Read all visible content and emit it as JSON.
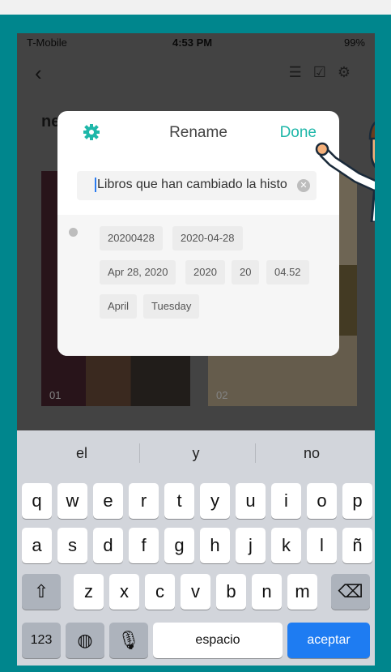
{
  "status": {
    "carrier": "T-Mobile",
    "time": "4:53 PM",
    "battery": "99%"
  },
  "doc": {
    "title_partial": "ne",
    "thumbs": [
      "01",
      "02"
    ]
  },
  "modal": {
    "title": "Rename",
    "done": "Done",
    "filename": "Libros que han cambiado la histo",
    "tags": [
      [
        "20200428",
        "2020-04-28"
      ],
      [
        "Apr 28, 2020",
        "2020",
        "20",
        "04.52"
      ],
      [
        "April",
        "Tuesday"
      ]
    ]
  },
  "keyboard": {
    "suggestions": [
      "el",
      "y",
      "no"
    ],
    "row1": [
      "q",
      "w",
      "e",
      "r",
      "t",
      "y",
      "u",
      "i",
      "o",
      "p"
    ],
    "row2": [
      "a",
      "s",
      "d",
      "f",
      "g",
      "h",
      "j",
      "k",
      "l",
      "ñ"
    ],
    "row3": [
      "z",
      "x",
      "c",
      "v",
      "b",
      "n",
      "m"
    ],
    "numbers_label": "123",
    "space_label": "espacio",
    "return_label": "aceptar"
  },
  "colors": {
    "frame": "#00868d",
    "accent": "#1fb7a9",
    "return_key": "#1e7cf2"
  },
  "icons": [
    "back-chevron-icon",
    "sort-icon",
    "select-icon",
    "settings-icon",
    "gear-icon",
    "clear-icon",
    "clock-icon",
    "shift-icon",
    "backspace-icon",
    "globe-icon",
    "microphone-icon"
  ]
}
